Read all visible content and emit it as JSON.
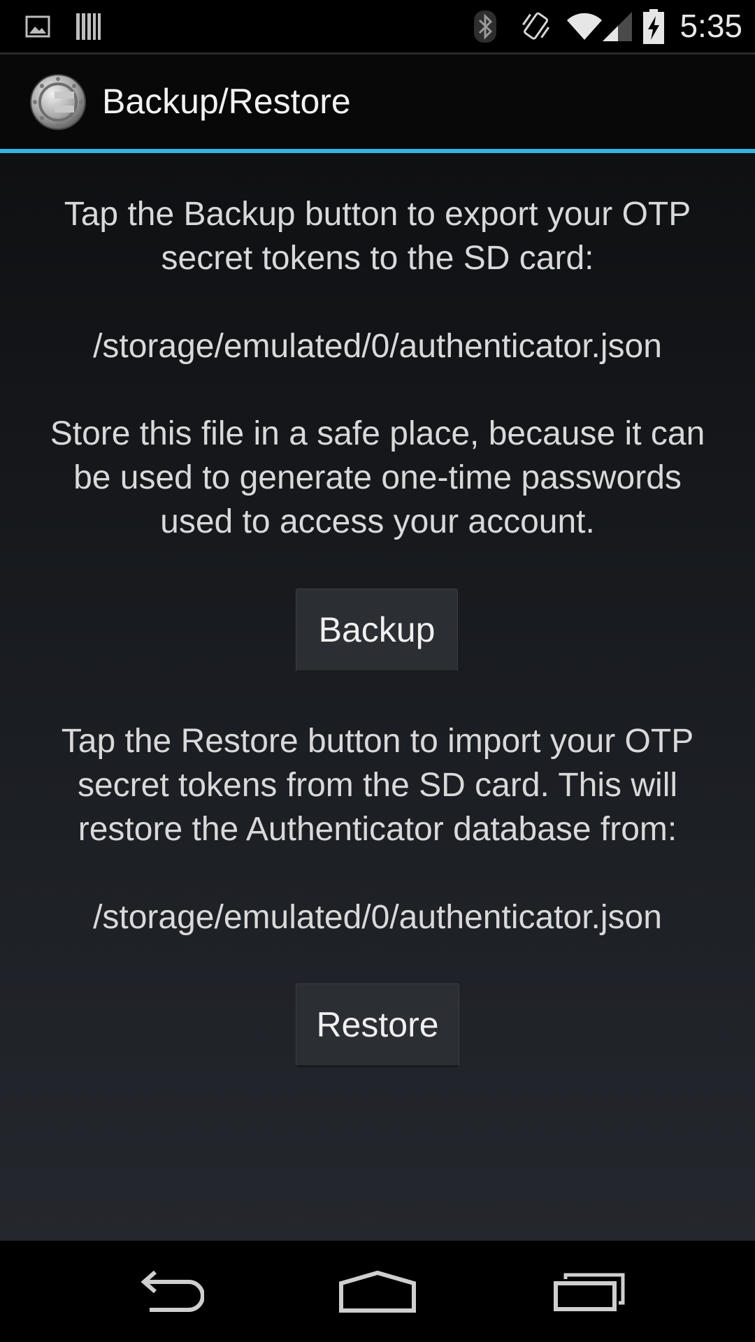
{
  "status_bar": {
    "time": "5:35",
    "icons": [
      "gallery-icon",
      "barcode-icon",
      "bluetooth-icon",
      "vibrate-icon",
      "wifi-icon",
      "cell-signal-icon",
      "battery-charging-icon"
    ]
  },
  "action_bar": {
    "title": "Backup/Restore",
    "logo": "authenticator-logo",
    "accent_color": "#33b5e5"
  },
  "content": {
    "backup_intro_line1": "Tap the Backup button to export your OTP",
    "backup_intro_line2": "secret tokens to the SD card:",
    "backup_path": "/storage/emulated/0/authenticator.json",
    "warning_line1": "Store this file in a safe place, because it can",
    "warning_line2": "be used to generate one-time passwords",
    "warning_line3": "used to access your account.",
    "backup_button": "Backup",
    "restore_intro_line1": "Tap the Restore button to import your OTP",
    "restore_intro_line2": "secret tokens from the SD card. This will",
    "restore_intro_line3": "restore the Authenticator database from:",
    "restore_path": "/storage/emulated/0/authenticator.json",
    "restore_button": "Restore"
  },
  "nav_bar": {
    "buttons": [
      "back-icon",
      "home-icon",
      "recent-apps-icon"
    ]
  }
}
